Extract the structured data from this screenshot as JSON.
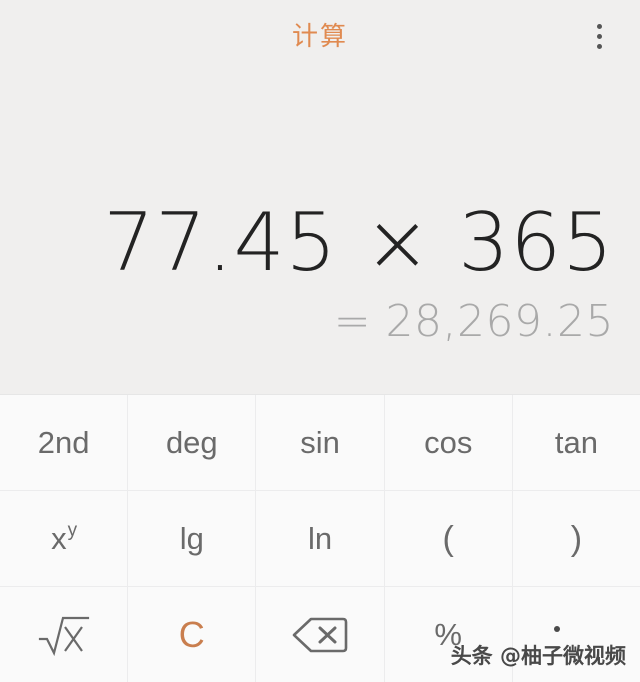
{
  "header": {
    "title": "计算",
    "title_color": "#e08a50",
    "overflow_icon": "more-vertical-icon"
  },
  "display": {
    "expression": "77.45 × 365",
    "result": "= 28,269.25",
    "expression_color": "#232323",
    "result_color": "#a9a9a9",
    "background": "#f0efee"
  },
  "keypad": {
    "background": "#fafafa",
    "accent_color": "#c97e4e",
    "rows": [
      {
        "keys": [
          {
            "name": "key-2nd",
            "label": "2nd",
            "type": "text"
          },
          {
            "name": "key-deg",
            "label": "deg",
            "type": "text"
          },
          {
            "name": "key-sin",
            "label": "sin",
            "type": "text"
          },
          {
            "name": "key-cos",
            "label": "cos",
            "type": "text"
          },
          {
            "name": "key-tan",
            "label": "tan",
            "type": "text"
          }
        ]
      },
      {
        "keys": [
          {
            "name": "key-power",
            "label": "x",
            "sup": "y",
            "type": "superscript"
          },
          {
            "name": "key-log10",
            "label": "lg",
            "type": "text"
          },
          {
            "name": "key-ln",
            "label": "ln",
            "type": "text"
          },
          {
            "name": "key-paren-open",
            "label": "(",
            "type": "paren"
          },
          {
            "name": "key-paren-close",
            "label": ")",
            "type": "paren"
          }
        ]
      },
      {
        "keys": [
          {
            "name": "key-sqrt",
            "label": "√x",
            "type": "icon",
            "icon": "square-root-icon"
          },
          {
            "name": "key-clear",
            "label": "C",
            "type": "accent"
          },
          {
            "name": "key-backspace",
            "label": "",
            "type": "icon",
            "icon": "backspace-icon"
          },
          {
            "name": "key-percent",
            "label": "%",
            "type": "text"
          },
          {
            "name": "key-blank",
            "label": "",
            "type": "blank"
          }
        ]
      }
    ]
  },
  "watermark": {
    "text": "头条 @柚子微视频"
  }
}
